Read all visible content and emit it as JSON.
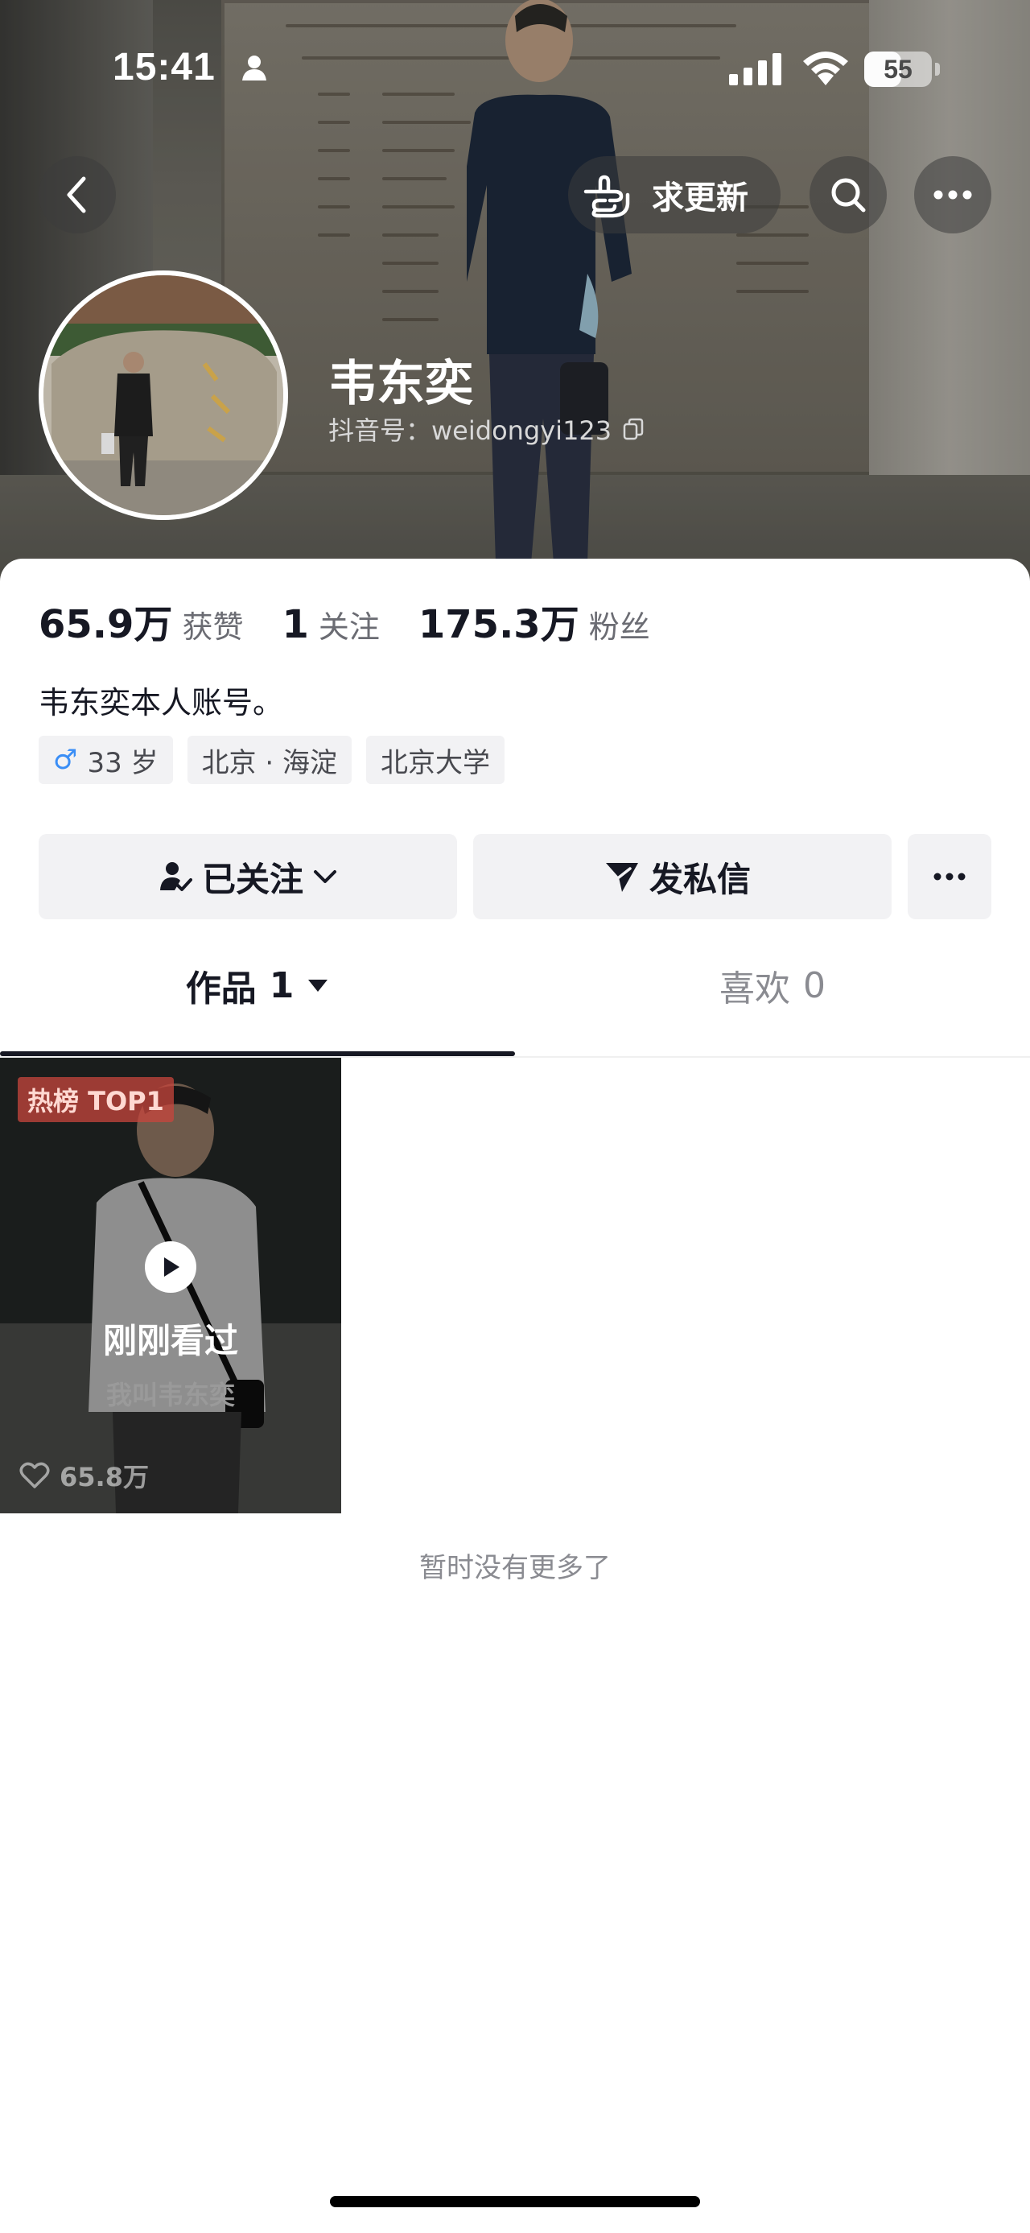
{
  "status_bar": {
    "time": "15:41",
    "battery": "55",
    "battery_level": 0.55
  },
  "header": {
    "update_request_label": "求更新",
    "icons": [
      "back-icon",
      "hand-pointer-icon",
      "search-icon",
      "more-icon"
    ]
  },
  "profile": {
    "name": "韦东奕",
    "douyin_id": "抖音号：weidongyi123"
  },
  "stats": [
    {
      "value": "65.9万",
      "label": "获赞"
    },
    {
      "value": "1",
      "label": "关注"
    },
    {
      "value": "175.3万",
      "label": "粉丝"
    }
  ],
  "bio": "韦东奕本人账号。",
  "tags": {
    "gender_age": "33 岁",
    "location": "北京 · 海淀",
    "school": "北京大学"
  },
  "actions": {
    "follow": "已关注",
    "message": "发私信"
  },
  "tabs": [
    {
      "label": "作品",
      "count": "1"
    },
    {
      "label": "喜欢",
      "count": "0"
    }
  ],
  "videos": [
    {
      "badge": "热榜 TOP1",
      "overlay_text": "刚刚看过",
      "caption": "我叫韦东奕",
      "likes": "65.8万"
    }
  ],
  "footer_text": "暂时没有更多了",
  "colors": {
    "primary_text": "#161823",
    "secondary_text": "#8a8b91",
    "button_bg": "#f2f2f4",
    "male_blue": "#3a8ef6"
  }
}
